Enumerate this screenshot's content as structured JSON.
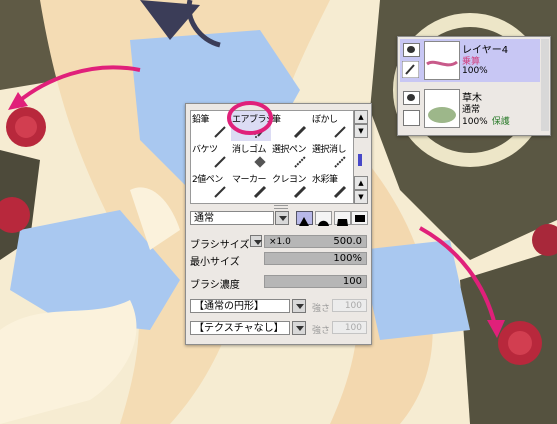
{
  "layers": [
    {
      "name": "レイヤー4",
      "mode": "乗算",
      "opacity": "100%",
      "protect": "",
      "selected": true,
      "mode_color": "#d04080"
    },
    {
      "name": "草木",
      "mode": "通常",
      "opacity": "100%",
      "protect": "保護",
      "selected": false,
      "mode_color": "#000000"
    }
  ],
  "tools": [
    {
      "label": "鉛筆",
      "icon": "pencil-icon",
      "active": false
    },
    {
      "label": "エアブラシ",
      "icon": "airbrush-icon",
      "active": true
    },
    {
      "label": "筆",
      "icon": "brush-icon",
      "active": false
    },
    {
      "label": "ぼかし",
      "icon": "blur-icon",
      "active": false
    },
    {
      "label": "バケツ",
      "icon": "bucket-icon",
      "active": false
    },
    {
      "label": "消しゴム",
      "icon": "eraser-icon",
      "active": false
    },
    {
      "label": "選択ペン",
      "icon": "select-pen-icon",
      "active": false
    },
    {
      "label": "選択消し",
      "icon": "select-erase-icon",
      "active": false
    },
    {
      "label": "2値ペン",
      "icon": "binary-pen-icon",
      "active": false
    },
    {
      "label": "マーカー",
      "icon": "marker-icon",
      "active": false
    },
    {
      "label": "クレヨン",
      "icon": "crayon-icon",
      "active": false
    },
    {
      "label": "水彩筆",
      "icon": "watercolor-icon",
      "active": false
    }
  ],
  "brush": {
    "blend_mode": "通常",
    "size_label": "ブラシサイズ",
    "size_multiplier": "×1.0",
    "size_value": "500.0",
    "min_size_label": "最小サイズ",
    "min_size_value": "100%",
    "min_size_level": 1.0,
    "density_label": "ブラシ濃度",
    "density_value": "100",
    "density_level": 1.0,
    "shape_select": "【通常の円形】",
    "texture_select": "【テクスチャなし】",
    "strength_label": "強さ",
    "strength_value": "100"
  },
  "colors": {
    "panel_bg": "#ece8e4",
    "layer_selected": "#c8c7f4",
    "highlight_circle": "#e0207a",
    "arrow": "#e0207a",
    "mode_multiply": "#d04080",
    "protect": "#2e7d2e"
  }
}
